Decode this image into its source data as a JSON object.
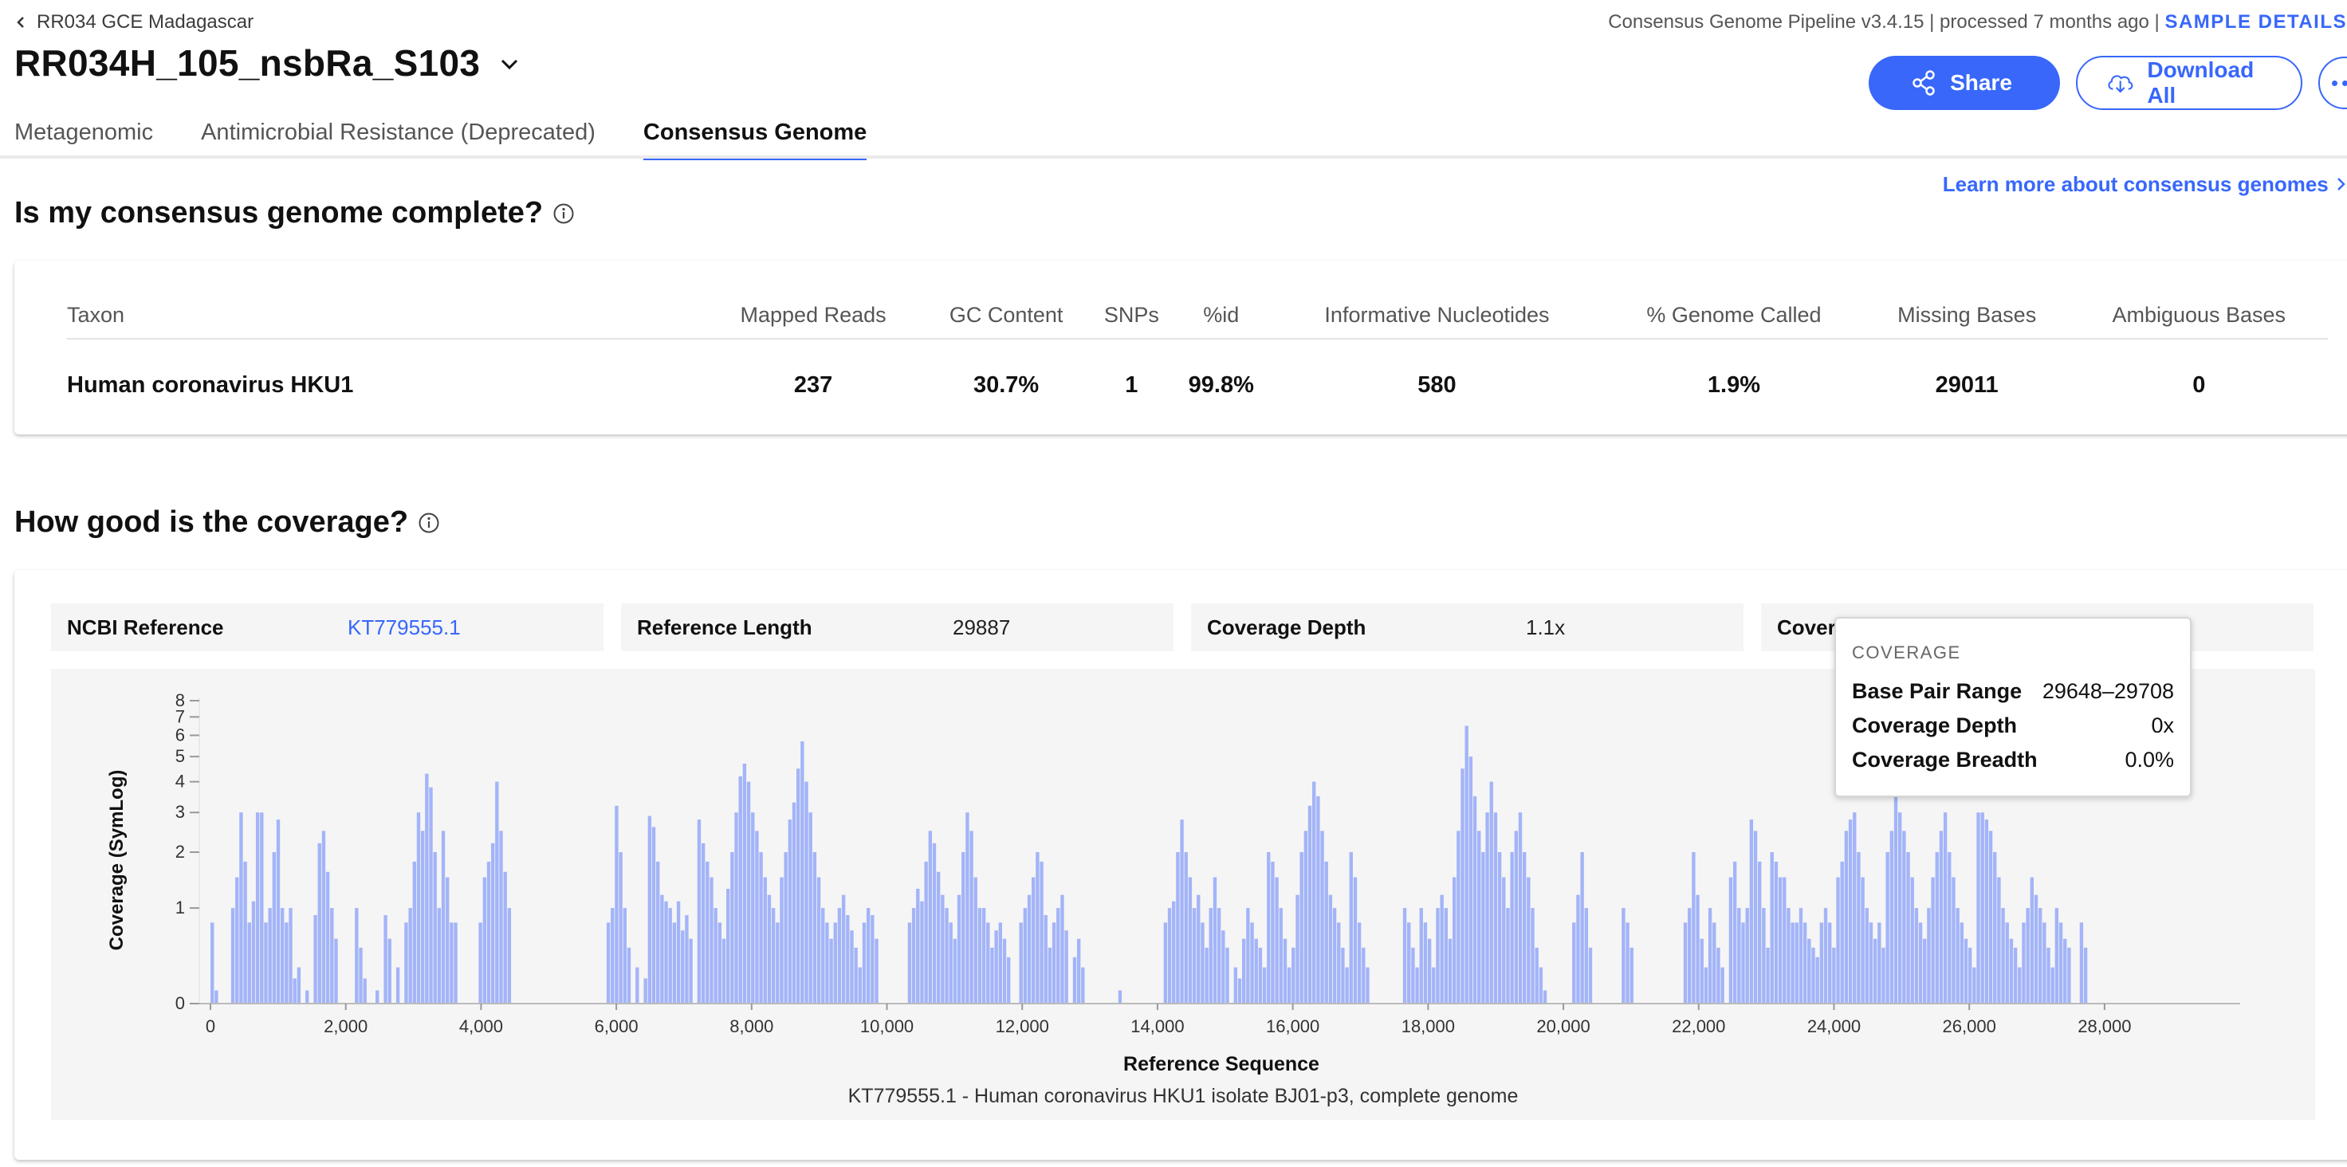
{
  "header": {
    "back_label": "RR034 GCE Madagascar",
    "sample_name": "RR034H_105_nsbRa_S103",
    "pipeline_info": "Consensus Genome Pipeline v3.4.15 | processed 7 months ago | ",
    "sample_details": "SAMPLE DETAILS",
    "share_label": "Share",
    "download_label": "Download All"
  },
  "tabs": [
    {
      "label": "Metagenomic"
    },
    {
      "label": "Antimicrobial Resistance (Deprecated)"
    },
    {
      "label": "Consensus Genome"
    }
  ],
  "learn_more": "Learn more about consensus genomes",
  "completeness": {
    "title": "Is my consensus genome complete?",
    "columns": [
      "Taxon",
      "Mapped Reads",
      "GC Content",
      "SNPs",
      "%id",
      "Informative Nucleotides",
      "% Genome Called",
      "Missing Bases",
      "Ambiguous Bases"
    ],
    "row": [
      "Human coronavirus HKU1",
      "237",
      "30.7%",
      "1",
      "99.8%",
      "580",
      "1.9%",
      "29011",
      "0"
    ]
  },
  "coverage": {
    "title": "How good is the coverage?",
    "ncbi_label": "NCBI Reference",
    "ncbi_value": "KT779555.1",
    "length_label": "Reference Length",
    "length_value": "29887",
    "depth_label": "Coverage Depth",
    "depth_value": "1.1x",
    "breadth_label": "Coverage Breadth",
    "breadth_value": ""
  },
  "tooltip": {
    "title": "COVERAGE",
    "range_label": "Base Pair Range",
    "range_value": "29648–29708",
    "depth_label": "Coverage Depth",
    "depth_value": "0x",
    "breadth_label": "Coverage Breadth",
    "breadth_value": "0.0%"
  },
  "colors": {
    "accent": "#3867fa",
    "bar": "#a3b4f8"
  },
  "chart_data": {
    "type": "bar",
    "xlabel": "Reference Sequence",
    "ylabel": "Coverage (SymLog)",
    "subtitle": "KT779555.1 - Human coronavirus HKU1 isolate BJ01-p3, complete genome",
    "xlim": [
      0,
      29887
    ],
    "ylim": [
      0,
      8
    ],
    "y_scale": "symlog",
    "bin_width": 61,
    "x_ticks": [
      0,
      2000,
      4000,
      6000,
      8000,
      10000,
      12000,
      14000,
      16000,
      18000,
      20000,
      22000,
      24000,
      26000,
      28000
    ],
    "x_tick_labels": [
      "0",
      "2,000",
      "4,000",
      "6,000",
      "8,000",
      "10,000",
      "12,000",
      "14,000",
      "16,000",
      "18,000",
      "20,000",
      "22,000",
      "24,000",
      "26,000",
      "28,000"
    ],
    "y_ticks": [
      0,
      1,
      2,
      3,
      4,
      5,
      6,
      7,
      8
    ],
    "y_tick_labels": [
      "0",
      "1",
      "2",
      "3",
      "4",
      "5",
      "6",
      "7",
      "8"
    ],
    "values": [
      0.8,
      0.1,
      0,
      0,
      0,
      1,
      1.5,
      3,
      1.8,
      0.8,
      1.1,
      3,
      3,
      0.8,
      1,
      2,
      2.8,
      1,
      0.8,
      1,
      0.2,
      0.3,
      0,
      0.1,
      0,
      0.9,
      2.2,
      2.5,
      1.6,
      1,
      0.6,
      0,
      0,
      0,
      0,
      1,
      0.5,
      0.2,
      0,
      0,
      0.1,
      0,
      0.9,
      0.6,
      0,
      0.3,
      0,
      0.8,
      1,
      1.8,
      3,
      2.5,
      4.3,
      3.8,
      2,
      1,
      2.5,
      1.5,
      0.8,
      0.8,
      0,
      0,
      0,
      0,
      0,
      0.8,
      1.5,
      1.8,
      2.2,
      4,
      2.5,
      1.6,
      1,
      0,
      0,
      0,
      0,
      0,
      0,
      0,
      0,
      0,
      0,
      0,
      0,
      0,
      0,
      0,
      0,
      0,
      0,
      0,
      0,
      0,
      0,
      0,
      0.8,
      1,
      3.2,
      2,
      1,
      0.5,
      0,
      0.3,
      0,
      0.2,
      2.9,
      2.6,
      1.8,
      1.2,
      1.1,
      1,
      0.8,
      1.1,
      0.7,
      0.9,
      0.6,
      0,
      2.8,
      2.2,
      1.8,
      1.5,
      1,
      0.8,
      0.6,
      1.3,
      2,
      3,
      4.2,
      4.7,
      4,
      3,
      2.5,
      2,
      1.5,
      1.2,
      1,
      0.8,
      1.5,
      2,
      2.8,
      3.3,
      4.5,
      5.7,
      4,
      3,
      2,
      1.5,
      1,
      0.8,
      0.6,
      0.8,
      1,
      1.2,
      0.9,
      0.7,
      0.5,
      0.3,
      0.8,
      1,
      0.9,
      0.6,
      0,
      0,
      0,
      0,
      0,
      0,
      0,
      0.8,
      1,
      1.3,
      1.1,
      1.8,
      2.5,
      2.2,
      1.6,
      1.2,
      1,
      0.8,
      0.6,
      1.2,
      2,
      3,
      2.5,
      1.5,
      1,
      1,
      0.8,
      0.5,
      0.7,
      0.8,
      0.6,
      0.4,
      0,
      0,
      0.8,
      1,
      1.2,
      1.5,
      2,
      1.8,
      0.9,
      0.5,
      0.8,
      1,
      1.2,
      0.7,
      0,
      0.4,
      0.6,
      0.3,
      0,
      0,
      0,
      0,
      0,
      0,
      0,
      0,
      0.1,
      0,
      0,
      0,
      0,
      0,
      0,
      0,
      0,
      0,
      0,
      0.8,
      1,
      1.1,
      2,
      2.8,
      2,
      1.5,
      1,
      1.2,
      0.8,
      0.5,
      1,
      1.5,
      1,
      0.7,
      0.5,
      0,
      0.3,
      0.2,
      0.6,
      1,
      0.8,
      0.6,
      0.5,
      0.3,
      2,
      1.8,
      1.5,
      1,
      0.6,
      0.3,
      0.5,
      1.2,
      2,
      2.5,
      3.2,
      4,
      3.5,
      2.5,
      1.8,
      1.2,
      1,
      0.8,
      0.5,
      0.3,
      2,
      1.5,
      0.8,
      0.5,
      0.3,
      0,
      0,
      0,
      0,
      0,
      0,
      0,
      0,
      1,
      0.8,
      0.5,
      0.3,
      1,
      0.8,
      0.6,
      0.3,
      1,
      1.2,
      1,
      0.6,
      1.5,
      2.5,
      4.5,
      6.5,
      5,
      3.5,
      2.5,
      2,
      3,
      4,
      3,
      2,
      1.5,
      1,
      2,
      2.5,
      3,
      2,
      1.5,
      1,
      0.5,
      0.3,
      0.1,
      0,
      0,
      0,
      0,
      0,
      0,
      0.8,
      1.2,
      2,
      1,
      0.5,
      0,
      0,
      0,
      0,
      0,
      0,
      0,
      1,
      0.8,
      0.5,
      0,
      0,
      0,
      0,
      0,
      0,
      0,
      0,
      0,
      0,
      0,
      0,
      0.8,
      1,
      2,
      1.2,
      0.6,
      0.3,
      1,
      0.8,
      0.5,
      0.3,
      0,
      1.5,
      1.8,
      1,
      0.8,
      1,
      2.8,
      2.5,
      1.8,
      1,
      0.5,
      2,
      1.8,
      1.5,
      1.5,
      1,
      0.8,
      0.8,
      1,
      0.8,
      0.6,
      0.5,
      0.4,
      0.8,
      1,
      0.8,
      0.5,
      1.5,
      1.8,
      2.5,
      2.8,
      3,
      2,
      1.5,
      1,
      0.8,
      0.6,
      0.8,
      0.5,
      2,
      2.5,
      3.5,
      3,
      2.5,
      2,
      1.5,
      1,
      0.8,
      0.6,
      1,
      1.5,
      2,
      2.5,
      3,
      2,
      1.5,
      1,
      0.8,
      0.6,
      0.5,
      0.3,
      3,
      3,
      2.8,
      2.5,
      2,
      1.5,
      1,
      0.8,
      0.6,
      0.5,
      0.3,
      0.8,
      1,
      1.5,
      1.2,
      1,
      0.8,
      0.5,
      0.3,
      1,
      0.8,
      0.6,
      0.5,
      0,
      0,
      0.8,
      0.5,
      0
    ]
  }
}
